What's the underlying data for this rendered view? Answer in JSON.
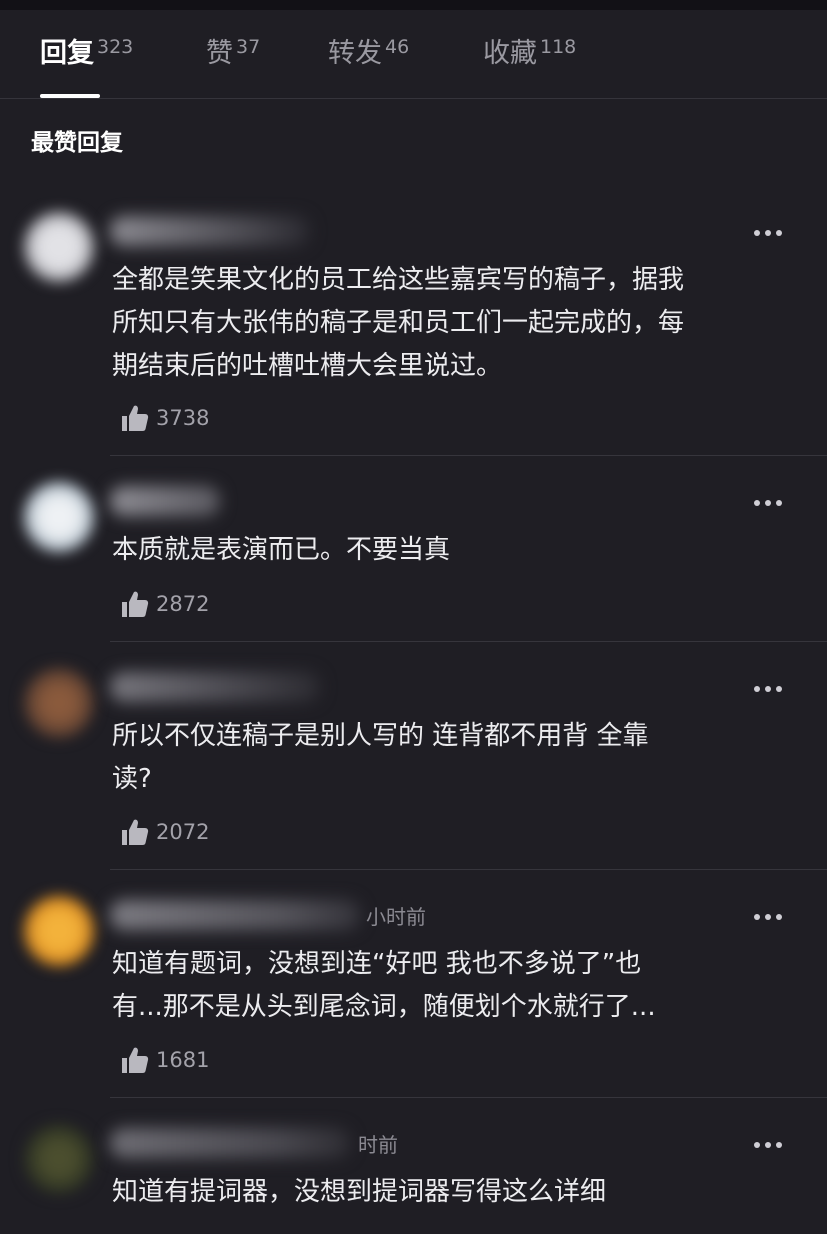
{
  "tabs": [
    {
      "label": "回复",
      "count": "323"
    },
    {
      "label": "赞",
      "count": "37"
    },
    {
      "label": "转发",
      "count": "46"
    },
    {
      "label": "收藏",
      "count": "118"
    }
  ],
  "section_title": "最赞回复",
  "comments": [
    {
      "time": "",
      "text_lines": [
        "全都是笑果文化的员工给这些嘉宾写的稿子，据我",
        "所知只有大张伟的稿子是和员工们一起完成的，每",
        "期结束后的吐槽吐槽大会里说过。"
      ],
      "likes": "3738"
    },
    {
      "time": "",
      "text_lines": [
        "本质就是表演而已。不要当真"
      ],
      "likes": "2872"
    },
    {
      "time": "",
      "text_lines": [
        "所以不仅连稿子是别人写的 连背都不用背 全靠",
        "读?"
      ],
      "likes": "2072"
    },
    {
      "time": "小时前",
      "text_lines": [
        "知道有题词，没想到连“好吧 我也不多说了”也",
        "有...那不是从头到尾念词，随便划个水就行了..."
      ],
      "likes": "1681"
    },
    {
      "time": "时前",
      "text_lines": [
        "知道有提词器，没想到提词器写得这么详细"
      ],
      "likes": ""
    }
  ],
  "colors": {
    "background": "#1f1e24",
    "text": "#ececef",
    "muted": "#9a99a1",
    "active_tab": "#ffffff"
  }
}
